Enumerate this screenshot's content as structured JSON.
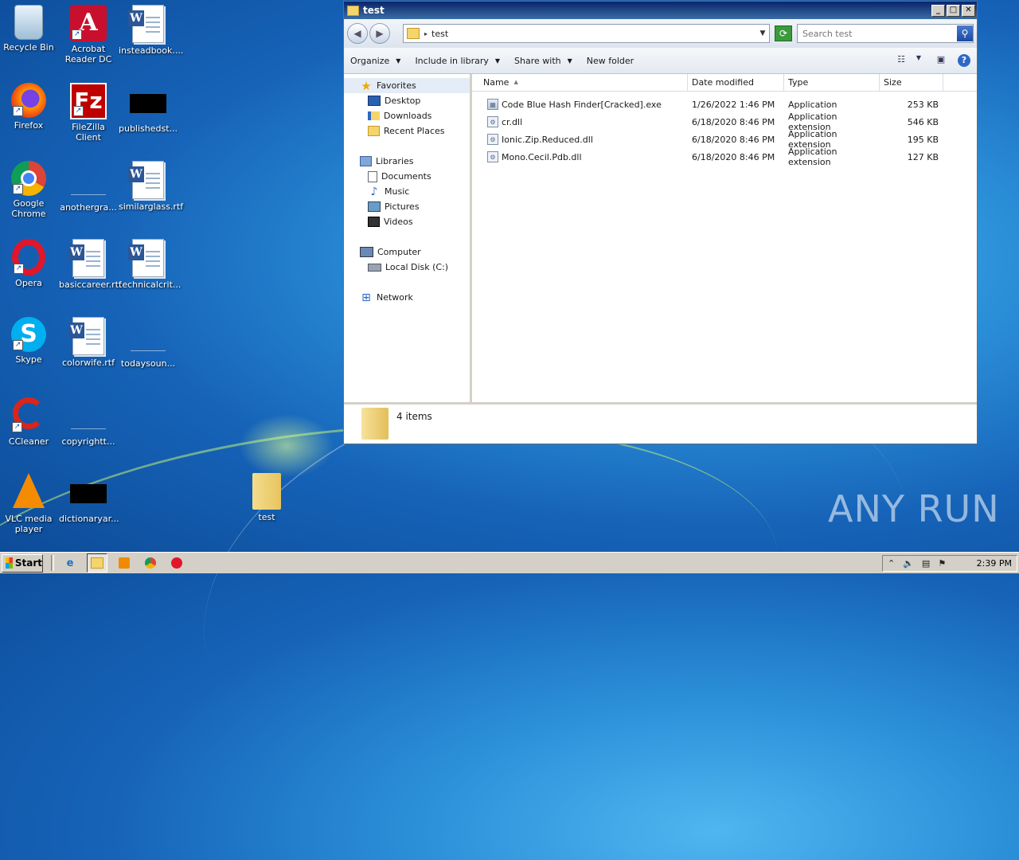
{
  "desktop": {
    "icons": [
      {
        "label": "Recycle Bin"
      },
      {
        "label": "Acrobat Reader DC"
      },
      {
        "label": "insteadbook...."
      },
      {
        "label": "Firefox"
      },
      {
        "label": "FileZilla Client"
      },
      {
        "label": "publishedst..."
      },
      {
        "label": "Google Chrome"
      },
      {
        "label": "anothergra..."
      },
      {
        "label": "similarglass.rtf"
      },
      {
        "label": "Opera"
      },
      {
        "label": "basiccareer.rtf"
      },
      {
        "label": "technicalcrit..."
      },
      {
        "label": "Skype"
      },
      {
        "label": "colorwife.rtf"
      },
      {
        "label": "todaysoun..."
      },
      {
        "label": "CCleaner"
      },
      {
        "label": "copyrightt..."
      },
      {
        "label": "VLC media player"
      },
      {
        "label": "dictionaryar..."
      },
      {
        "label": "test"
      }
    ]
  },
  "window": {
    "title": "test",
    "address": "test",
    "search_placeholder": "Search test",
    "toolbar": {
      "organize": "Organize",
      "include_in_library": "Include in library",
      "share_with": "Share with",
      "new_folder": "New folder"
    },
    "nav": {
      "favorites": "Favorites",
      "desktop": "Desktop",
      "downloads": "Downloads",
      "recent_places": "Recent Places",
      "libraries": "Libraries",
      "documents": "Documents",
      "music": "Music",
      "pictures": "Pictures",
      "videos": "Videos",
      "computer": "Computer",
      "local_disk": "Local Disk (C:)",
      "network": "Network"
    },
    "columns": {
      "name": "Name",
      "date_modified": "Date modified",
      "type": "Type",
      "size": "Size"
    },
    "files": [
      {
        "name": "Code Blue Hash Finder[Cracked].exe",
        "date": "1/26/2022 1:46 PM",
        "type": "Application",
        "size": "253 KB"
      },
      {
        "name": "cr.dll",
        "date": "6/18/2020 8:46 PM",
        "type": "Application extension",
        "size": "546 KB"
      },
      {
        "name": "Ionic.Zip.Reduced.dll",
        "date": "6/18/2020 8:46 PM",
        "type": "Application extension",
        "size": "195 KB"
      },
      {
        "name": "Mono.Cecil.Pdb.dll",
        "date": "6/18/2020 8:46 PM",
        "type": "Application extension",
        "size": "127 KB"
      }
    ],
    "item_count": "4 items"
  },
  "taskbar": {
    "start_label": "Start",
    "clock": "2:39 PM"
  },
  "watermark": "ANY RUN"
}
